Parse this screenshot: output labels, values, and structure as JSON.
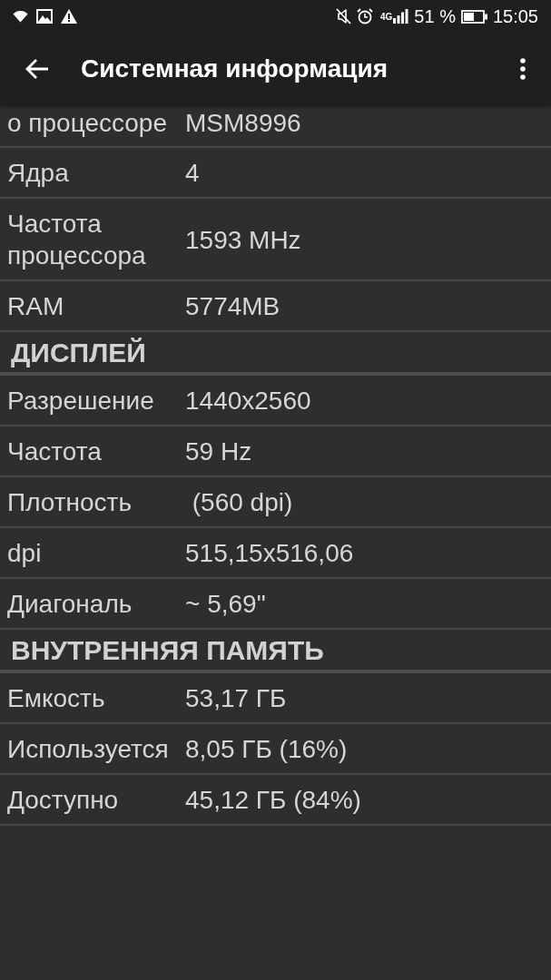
{
  "status_bar": {
    "network": "4G",
    "battery": "51 %",
    "time": "15:05"
  },
  "app_bar": {
    "title": "Системная информация"
  },
  "list": [
    {
      "kind": "row",
      "label": "о процессоре",
      "value": "MSM8996"
    },
    {
      "kind": "row",
      "label": "Ядра",
      "value": "4"
    },
    {
      "kind": "row",
      "label": "Частота процессора",
      "value": "1593 MHz"
    },
    {
      "kind": "row",
      "label": "RAM",
      "value": "5774MB"
    },
    {
      "kind": "header",
      "title": "ДИСПЛЕЙ"
    },
    {
      "kind": "row",
      "label": "Разрешение",
      "value": "1440x2560"
    },
    {
      "kind": "row",
      "label": "Частота",
      "value": "59 Hz"
    },
    {
      "kind": "row",
      "label": "Плотность",
      "value": " (560 dpi)"
    },
    {
      "kind": "row",
      "label": "dpi",
      "value": "515,15x516,06"
    },
    {
      "kind": "row",
      "label": "Диагональ",
      "value": "~ 5,69\""
    },
    {
      "kind": "header",
      "title": "ВНУТРЕННЯЯ ПАМЯТЬ"
    },
    {
      "kind": "row",
      "label": "Емкость",
      "value": "53,17 ГБ"
    },
    {
      "kind": "row",
      "label": "Используется",
      "value": "8,05 ГБ (16%)"
    },
    {
      "kind": "row",
      "label": "Доступно",
      "value": "45,12 ГБ (84%)"
    }
  ]
}
